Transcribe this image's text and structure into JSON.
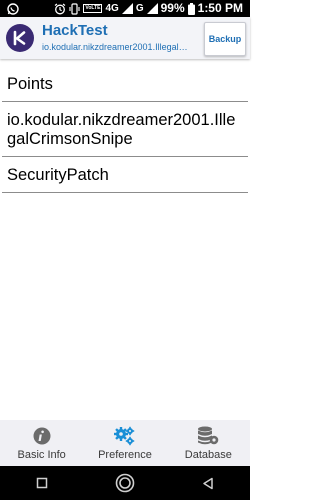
{
  "status_bar": {
    "lte_badge": "VoLTE",
    "network_4g": "4G",
    "network_g": "G",
    "battery": "99%",
    "time": "1:50 PM",
    "icons": [
      "whatsapp-icon",
      "alarm-icon",
      "wifi-calling-icon",
      "vibrate-icon",
      "signal-icon",
      "battery-icon"
    ]
  },
  "app_bar": {
    "title": "HackTest",
    "subtitle": "io.kodular.nikzdreamer2001.IllegalCri...",
    "backup_label": "Backup",
    "logo_color": "#3a2a73",
    "accent_color": "#1f6fb4"
  },
  "list": {
    "items": [
      {
        "label": "Points"
      },
      {
        "label": "io.kodular.nikzdreamer2001.IllegalCrimsonSnipe"
      },
      {
        "label": "SecurityPatch"
      }
    ]
  },
  "bottom_nav": {
    "items": [
      {
        "label": "Basic Info",
        "icon": "info-icon"
      },
      {
        "label": "Preference",
        "icon": "gears-icon",
        "active": true
      },
      {
        "label": "Database",
        "icon": "database-icon"
      }
    ],
    "active_color": "#1a8fd6"
  },
  "system_nav": {
    "buttons": [
      "recents-button",
      "home-button",
      "back-button"
    ]
  }
}
